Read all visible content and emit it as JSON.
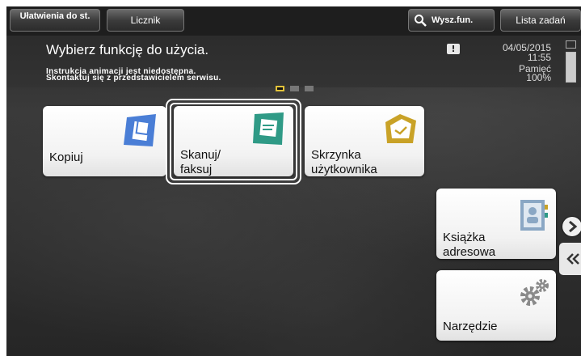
{
  "topbar": {
    "accessibility_label": "Ułatwienia do st.",
    "counter_label": "Licznik",
    "search_label": "Wysz.fun.",
    "jobs_label": "Lista zadań"
  },
  "message": {
    "title": "Wybierz funkcję do użycia.",
    "line1": "Instrukcja animacji jest niedostępna.",
    "line2": "Skontaktuj się z przedstawicielem serwisu."
  },
  "status": {
    "warning_symbol": "!",
    "date": "04/05/2015",
    "time": "11:55",
    "memory_label": "Pamięć",
    "memory_value": "100%",
    "memory_fraction": 1.0
  },
  "pager": {
    "current": 1,
    "total": 3
  },
  "tiles": {
    "copy": "Kopiuj",
    "scan_l1": "Skanuj/",
    "scan_l2": "faksuj",
    "box_l1": "Skrzynka",
    "box_l2": "użytkownika",
    "addr_l1": "Książka",
    "addr_l2": "adresowa",
    "tool": "Narzędzie"
  },
  "colors": {
    "copy_icon": "#4a7ed6",
    "scan_icon": "#2f9a86",
    "box_icon": "#c9a227",
    "addr_icon": "#8aa7c4",
    "tool_icon": "#8a8a8a",
    "page_dot_active": "#e2c23a"
  },
  "icons": {
    "search": "search-icon",
    "next": "chevron-right-icon",
    "back": "double-chevron-left-icon"
  }
}
